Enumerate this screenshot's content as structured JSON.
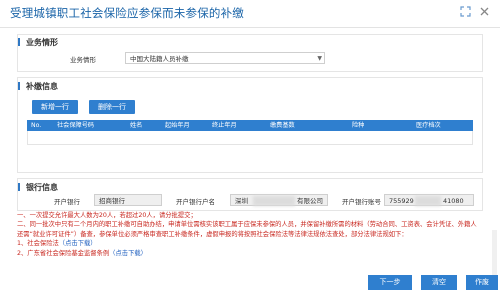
{
  "window": {
    "title": "受理城镇职工社会保险应参保而未参保的补缴"
  },
  "business": {
    "section_title": "业务情形",
    "case_label": "业务情形",
    "case_value": "中国大陆籍人员补缴"
  },
  "supplement": {
    "section_title": "补缴信息",
    "add_row": "新增一行",
    "delete_row": "删除一行",
    "columns": [
      "No.",
      "社会保障号码",
      "姓名",
      "起始年月",
      "终止年月",
      "缴费基数",
      "险种",
      "医疗档次"
    ]
  },
  "bank": {
    "section_title": "银行信息",
    "bank_label": "开户银行",
    "bank_value": "招商银行",
    "account_name_label": "开户银行户名",
    "account_name_value": "深圳",
    "account_name_suffix": "有限公司",
    "account_no_label": "开户银行账号",
    "account_no_prefix": "755929",
    "account_no_suffix": "41080"
  },
  "notes": {
    "line1": "一、一次提交允许最大人数为20人，若超过20人，请分批提交；",
    "line2": "二、同一批次中只有二个月内的职工补缴可自助办结，申请单位需核实该职工属于应保未参保的人员，并保留补缴所需的材料（劳动合同、工资表、会计凭证、外籍人还需“就业许可证件”）备查，参保单位必须严格审查职工补缴条件，虚假申报的将按照社会保险法等法律法规依法查处，部分法律法规如下：",
    "item1_text": "1、社会保险法",
    "item1_link": "（点击下载）",
    "item2_text": "2、广东省社会保险基金监督条例",
    "item2_link": "（点击下载）"
  },
  "footer": {
    "next": "下一步",
    "clear": "清空",
    "void": "作废"
  },
  "colors": {
    "accent": "#2f7fcf",
    "title": "#1a64a8",
    "warning": "#c8261e"
  }
}
